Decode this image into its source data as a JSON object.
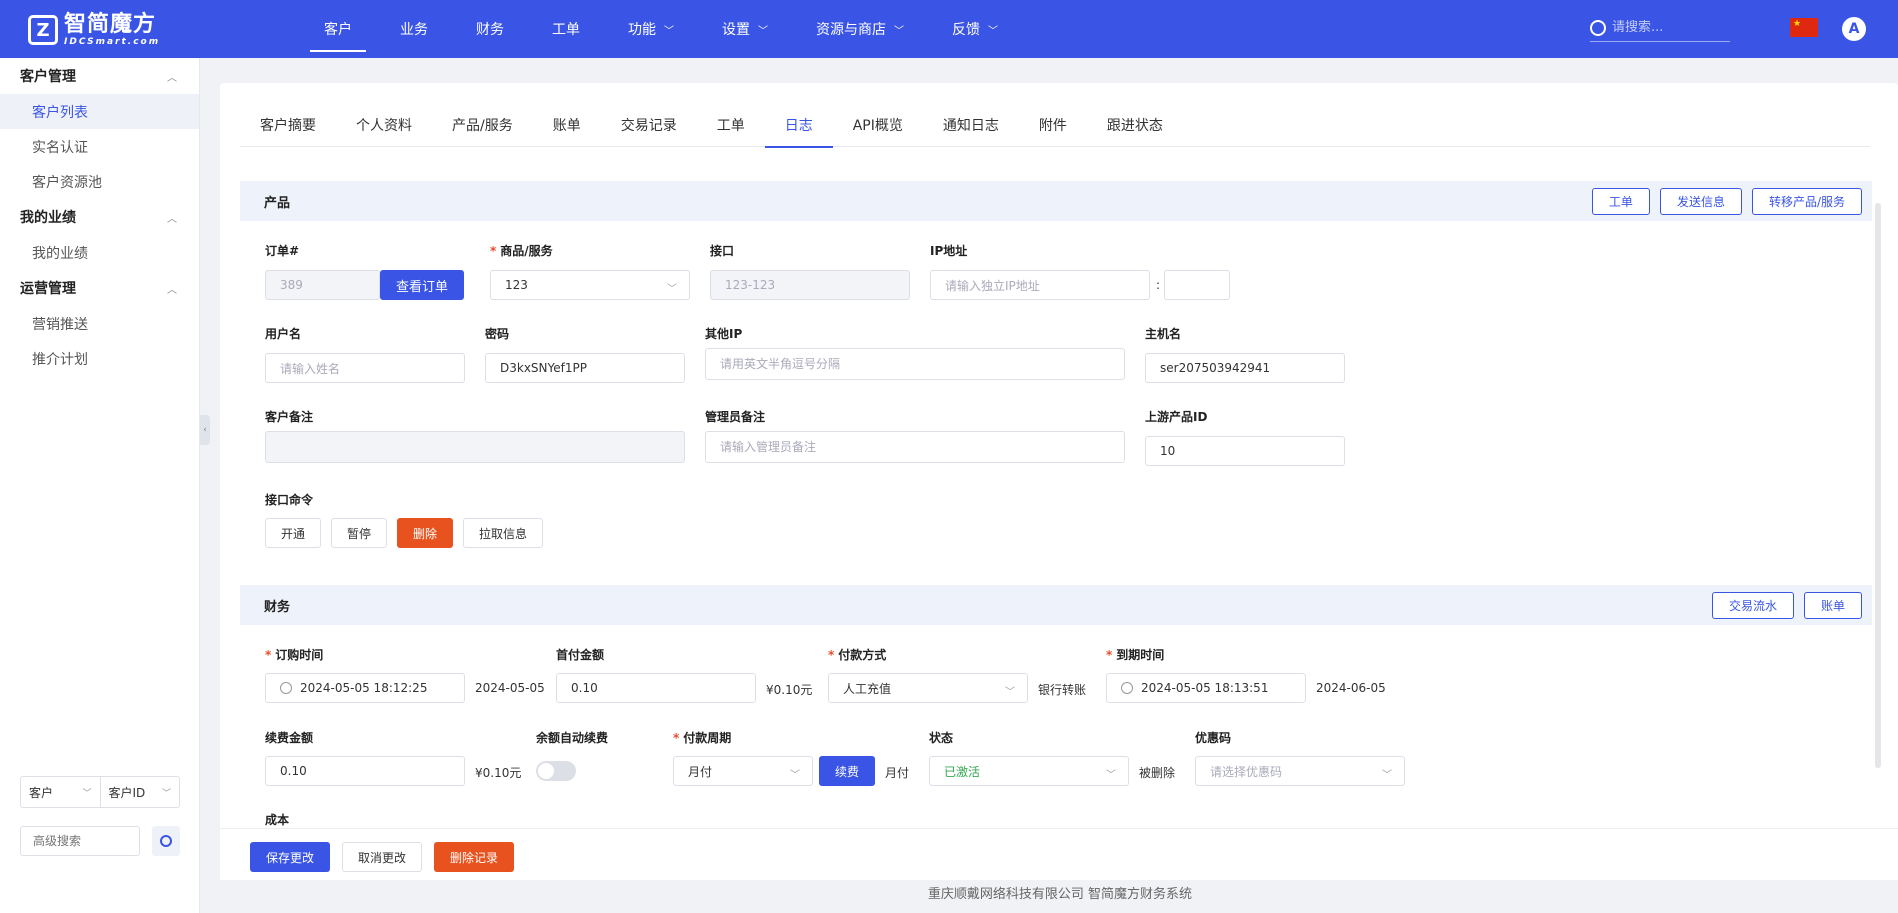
{
  "brand": {
    "cn": "智简魔方",
    "en": "IDCSmart.com"
  },
  "nav": [
    {
      "label": "客户",
      "active": true,
      "dropdown": false
    },
    {
      "label": "业务",
      "dropdown": false
    },
    {
      "label": "财务",
      "dropdown": false
    },
    {
      "label": "工单",
      "dropdown": false
    },
    {
      "label": "功能",
      "dropdown": true
    },
    {
      "label": "设置",
      "dropdown": true
    },
    {
      "label": "资源与商店",
      "dropdown": true
    },
    {
      "label": "反馈",
      "dropdown": true
    }
  ],
  "top_search_placeholder": "请搜索...",
  "avatar_letter": "A",
  "sidebar": {
    "groups": [
      {
        "label": "客户管理",
        "items": [
          "客户列表",
          "实名认证",
          "客户资源池"
        ]
      },
      {
        "label": "我的业绩",
        "items": [
          "我的业绩"
        ]
      },
      {
        "label": "运营管理",
        "items": [
          "营销推送",
          "推介计划"
        ]
      }
    ],
    "active_item": "客户列表",
    "filter_type": "客户",
    "filter_field": "客户ID",
    "search_placeholder": "高级搜索"
  },
  "tabs": [
    "客户摘要",
    "个人资料",
    "产品/服务",
    "账单",
    "交易记录",
    "工单",
    "日志",
    "API概览",
    "通知日志",
    "附件",
    "跟进状态"
  ],
  "active_tab": "日志",
  "product": {
    "title": "产品",
    "head_buttons": [
      "工单",
      "发送信息",
      "转移产品/服务"
    ],
    "order_label": "订单#",
    "order_value": "389",
    "view_order": "查看订单",
    "goods_label": "商品/服务",
    "goods_value": "123",
    "interface_label": "接口",
    "interface_value": "123-123",
    "ip_label": "IP地址",
    "ip_placeholder": "请输入独立IP地址",
    "colon": ":",
    "username_label": "用户名",
    "username_placeholder": "请输入姓名",
    "password_label": "密码",
    "password_value": "D3kxSNYef1PP",
    "other_ip_label": "其他IP",
    "other_ip_placeholder": "请用英文半角逗号分隔",
    "hostname_label": "主机名",
    "hostname_value": "ser207503942941",
    "client_note_label": "客户备注",
    "admin_note_label": "管理员备注",
    "admin_note_placeholder": "请输入管理员备注",
    "upstream_label": "上游产品ID",
    "upstream_value": "10",
    "cmd_label": "接口命令",
    "cmd_buttons": [
      "开通",
      "暂停",
      "删除",
      "拉取信息"
    ]
  },
  "finance": {
    "title": "财务",
    "head_buttons": [
      "交易流水",
      "账单"
    ],
    "order_time_label": "订购时间",
    "order_time_value": "2024-05-05 18:12:25",
    "order_date_suffix": "2024-05-05",
    "first_amount_label": "首付金额",
    "first_amount_value": "0.10",
    "first_amount_suffix": "¥0.10元",
    "pay_method_label": "付款方式",
    "pay_method_value": "人工充值",
    "pay_method_suffix": "银行转账",
    "expire_label": "到期时间",
    "expire_value": "2024-05-05 18:13:51",
    "expire_suffix": "2024-06-05",
    "renew_amount_label": "续费金额",
    "renew_amount_value": "0.10",
    "renew_amount_suffix": "¥0.10元",
    "auto_renew_label": "余额自动续费",
    "cycle_label": "付款周期",
    "cycle_value": "月付",
    "renew_button": "续费",
    "cycle_suffix": "月付",
    "status_label": "状态",
    "status_value": "已激活",
    "status_suffix": "被删除",
    "coupon_label": "优惠码",
    "coupon_placeholder": "请选择优惠码",
    "cost_label": "成本"
  },
  "footer_buttons": {
    "save": "保存更改",
    "cancel": "取消更改",
    "delete": "删除记录"
  },
  "copyright": "重庆顺戴网络科技有限公司 智简魔方财务系统",
  "colors": {
    "primary": "#3a55e6",
    "danger": "#e8521e",
    "success": "#34a853"
  }
}
